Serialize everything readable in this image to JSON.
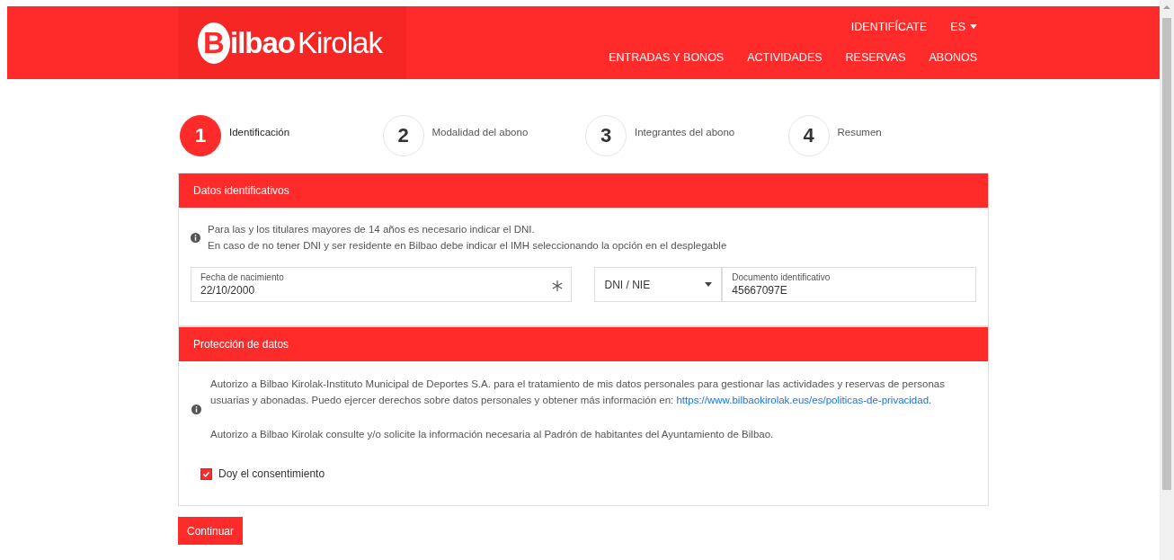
{
  "header": {
    "logo": {
      "initial": "B",
      "word1": "ilbao",
      "word2": "Kirolak"
    },
    "top_links": [
      {
        "label": "IDENTIFÍCATE",
        "kind": "link"
      },
      {
        "label": "ES",
        "kind": "dropdown"
      }
    ],
    "nav": [
      {
        "label": "ENTRADAS Y BONOS"
      },
      {
        "label": "ACTIVIDADES"
      },
      {
        "label": "RESERVAS"
      },
      {
        "label": "ABONOS"
      }
    ]
  },
  "steps": [
    {
      "number": "1",
      "label": "Identificación",
      "selected": true
    },
    {
      "number": "2",
      "label": "Modalidad del abono",
      "selected": false
    },
    {
      "number": "3",
      "label": "Integrantes del abono",
      "selected": false
    },
    {
      "number": "4",
      "label": "Resumen",
      "selected": false
    }
  ],
  "identification": {
    "title": "Datos identificativos",
    "info_lines": [
      "Para las y los titulares mayores de 14 años es necesario indicar el DNI.",
      "En caso de no tener DNI y ser residente en Bilbao debe indicar el IMH seleccionando la opción en el desplegable"
    ],
    "birth_date": {
      "label": "Fecha de nacimiento",
      "value": "22/10/2000"
    },
    "document_type": {
      "value": "DNI / NIE"
    },
    "document": {
      "label": "Documento identificativo",
      "value": "45667097E"
    }
  },
  "privacy": {
    "title": "Protección de datos",
    "paragraph1": {
      "text": "Autorizo a Bilbao Kirolak-Instituto Municipal de Deportes S.A. para el tratamiento de mis datos personales para gestionar las actividades y reservas de personas usuarias y abonadas. Puedo ejercer derechos sobre datos personales y obtener más información en: ",
      "link": "https://www.bilbaokirolak.eus/es/politicas-de-privacidad",
      "after": "."
    },
    "paragraph2": "Autorizo a Bilbao Kirolak consulte y/o solicite la información necesaria al Padrón de habitantes del Ayuntamiento de Bilbao.",
    "consent": {
      "label": "Doy el consentimiento",
      "checked": true
    }
  },
  "continue_button": "Continuar"
}
